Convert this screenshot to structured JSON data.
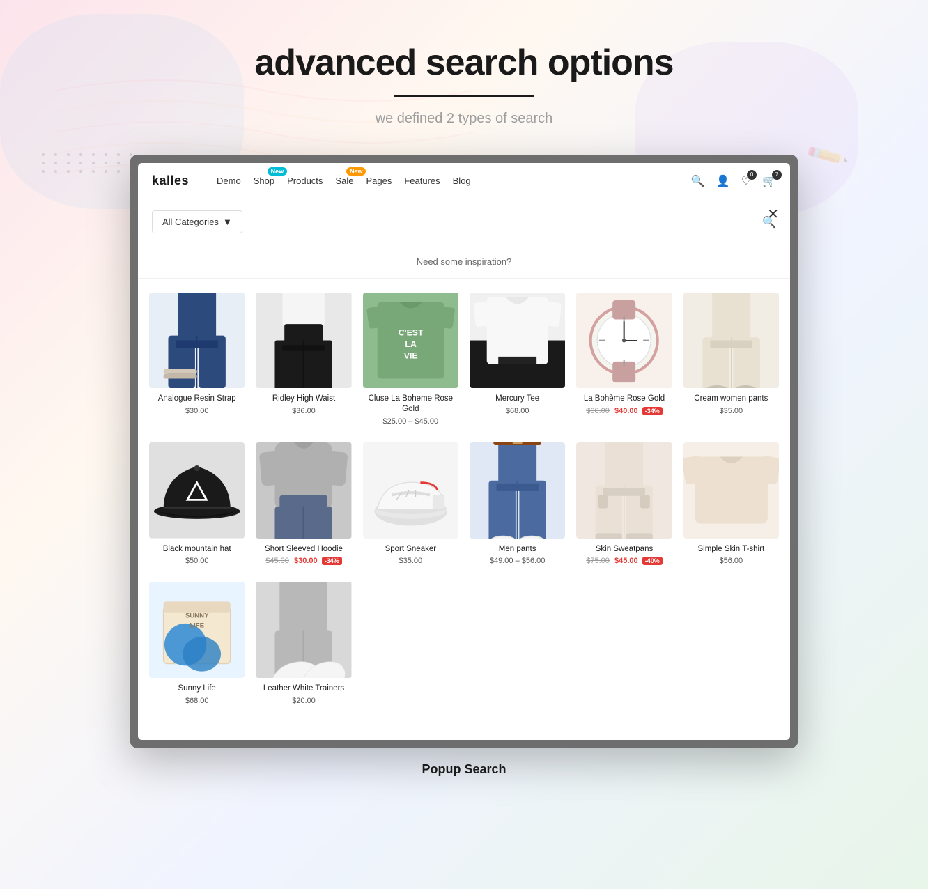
{
  "page": {
    "title": "advanced search  options",
    "underline": true,
    "subtitle": "we defined 2 types of search",
    "bottom_label": "Popup Search"
  },
  "navbar": {
    "logo": "kalles",
    "items": [
      {
        "label": "Demo",
        "badge": null
      },
      {
        "label": "Shop",
        "badge": {
          "text": "New",
          "color": "teal"
        }
      },
      {
        "label": "Products",
        "badge": null
      },
      {
        "label": "Sale",
        "badge": {
          "text": "New",
          "color": "orange"
        }
      },
      {
        "label": "Pages",
        "badge": null
      },
      {
        "label": "Features",
        "badge": null
      },
      {
        "label": "Blog",
        "badge": null
      }
    ],
    "icons": [
      {
        "name": "search",
        "badge": null
      },
      {
        "name": "account",
        "badge": null
      },
      {
        "name": "wishlist",
        "badge": "0"
      },
      {
        "name": "cart",
        "badge": "7"
      }
    ]
  },
  "search_popup": {
    "category_placeholder": "All Categories",
    "search_placeholder": "",
    "inspiration_label": "Need some inspiration?",
    "close_label": "×"
  },
  "products": [
    {
      "name": "Analogue Resin Strap",
      "price": "$30.00",
      "price_original": null,
      "price_sale": null,
      "discount": null,
      "img_class": "img-blue-pants",
      "img_type": "pants_blue"
    },
    {
      "name": "Ridley High Waist",
      "price": "$36.00",
      "price_original": null,
      "price_sale": null,
      "discount": null,
      "img_class": "img-black-pants",
      "img_type": "pants_black"
    },
    {
      "name": "Cluse La Boheme Rose Gold",
      "price": "$25.00 – $45.00",
      "price_original": null,
      "price_sale": null,
      "discount": null,
      "img_class": "img-green-tee",
      "img_type": "tee_green"
    },
    {
      "name": "Mercury Tee",
      "price": "$68.00",
      "price_original": null,
      "price_sale": null,
      "discount": null,
      "img_class": "img-white-shirt",
      "img_type": "shirt_white"
    },
    {
      "name": "La Bohème Rose Gold",
      "price": "$40.00",
      "price_original": "$60.00",
      "price_sale": "$40.00",
      "discount": "-34%",
      "img_class": "img-watch",
      "img_type": "watch"
    },
    {
      "name": "Cream women pants",
      "price": "$35.00",
      "price_original": null,
      "price_sale": null,
      "discount": null,
      "img_class": "img-cream-pants",
      "img_type": "pants_cream"
    },
    {
      "name": "Black mountain hat",
      "price": "$50.00",
      "price_original": null,
      "price_sale": null,
      "discount": null,
      "img_class": "img-black-hat",
      "img_type": "hat"
    },
    {
      "name": "Short Sleeved Hoodie",
      "price": "$30.00",
      "price_original": "$45.00",
      "price_sale": "$30.00",
      "discount": "-34%",
      "img_class": "img-grey-hoodie",
      "img_type": "hoodie_grey"
    },
    {
      "name": "Sport Sneaker",
      "price": "$35.00",
      "price_original": null,
      "price_sale": null,
      "discount": null,
      "img_class": "img-white-sneaker",
      "img_type": "sneaker"
    },
    {
      "name": "Men pants",
      "price": "$49.00 – $56.00",
      "price_original": null,
      "price_sale": null,
      "discount": null,
      "img_class": "img-blue-jeans",
      "img_type": "jeans_blue"
    },
    {
      "name": "Skin Sweatpans",
      "price": "$45.00",
      "price_original": "$75.00",
      "price_sale": "$45.00",
      "discount": "-40%",
      "img_class": "img-skin-sweatpants",
      "img_type": "sweatpants"
    },
    {
      "name": "Simple Skin T-shirt",
      "price": "$56.00",
      "price_original": null,
      "price_sale": null,
      "discount": null,
      "img_class": "img-simple-tee",
      "img_type": "tee_simple"
    },
    {
      "name": "Sunny Life",
      "price": "$68.00",
      "price_original": null,
      "price_sale": null,
      "discount": null,
      "img_class": "img-box-blue",
      "img_type": "box"
    },
    {
      "name": "Leather White Trainers",
      "price": "$20.00",
      "price_original": null,
      "price_sale": null,
      "discount": null,
      "img_class": "img-grey-pants",
      "img_type": "trainers"
    }
  ]
}
